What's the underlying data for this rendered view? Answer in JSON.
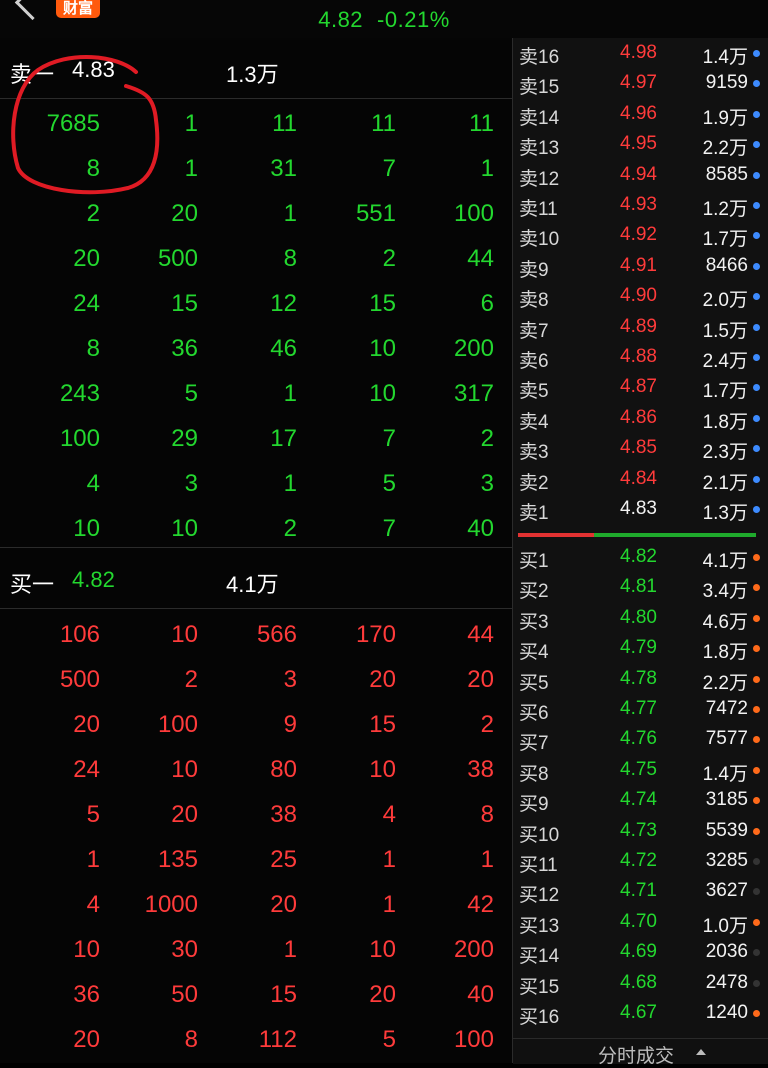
{
  "header": {
    "brand": "财富",
    "price": "4.82",
    "change": "-0.21%"
  },
  "colors": {
    "up": "#ff3b3b",
    "down": "#23d82f",
    "neutral": "#f2f2f2",
    "bar_red": "#e23232",
    "bar_green": "#1faa2c"
  },
  "sell_one": {
    "label": "卖一",
    "price": "4.83",
    "volume": "1.3万"
  },
  "sell_queue": [
    [
      "7685",
      "1",
      "11",
      "11",
      "11"
    ],
    [
      "8",
      "1",
      "31",
      "7",
      "1"
    ],
    [
      "2",
      "20",
      "1",
      "551",
      "100"
    ],
    [
      "20",
      "500",
      "8",
      "2",
      "44"
    ],
    [
      "24",
      "15",
      "12",
      "15",
      "6"
    ],
    [
      "8",
      "36",
      "46",
      "10",
      "200"
    ],
    [
      "243",
      "5",
      "1",
      "10",
      "317"
    ],
    [
      "100",
      "29",
      "17",
      "7",
      "2"
    ],
    [
      "4",
      "3",
      "1",
      "5",
      "3"
    ],
    [
      "10",
      "10",
      "2",
      "7",
      "40"
    ]
  ],
  "buy_one": {
    "label": "买一",
    "price": "4.82",
    "volume": "4.1万"
  },
  "buy_queue": [
    [
      "106",
      "10",
      "566",
      "170",
      "44"
    ],
    [
      "500",
      "2",
      "3",
      "20",
      "20"
    ],
    [
      "20",
      "100",
      "9",
      "15",
      "2"
    ],
    [
      "24",
      "10",
      "80",
      "10",
      "38"
    ],
    [
      "5",
      "20",
      "38",
      "4",
      "8"
    ],
    [
      "1",
      "135",
      "25",
      "1",
      "1"
    ],
    [
      "4",
      "1000",
      "20",
      "1",
      "42"
    ],
    [
      "10",
      "30",
      "1",
      "10",
      "200"
    ],
    [
      "36",
      "50",
      "15",
      "20",
      "40"
    ],
    [
      "20",
      "8",
      "112",
      "5",
      "100"
    ]
  ],
  "asks": [
    {
      "label": "卖16",
      "price": "4.98",
      "volume": "1.4万",
      "dot": "blue"
    },
    {
      "label": "卖15",
      "price": "4.97",
      "volume": "9159",
      "dot": "blue"
    },
    {
      "label": "卖14",
      "price": "4.96",
      "volume": "1.9万",
      "dot": "blue"
    },
    {
      "label": "卖13",
      "price": "4.95",
      "volume": "2.2万",
      "dot": "blue"
    },
    {
      "label": "卖12",
      "price": "4.94",
      "volume": "8585",
      "dot": "blue"
    },
    {
      "label": "卖11",
      "price": "4.93",
      "volume": "1.2万",
      "dot": "blue"
    },
    {
      "label": "卖10",
      "price": "4.92",
      "volume": "1.7万",
      "dot": "blue"
    },
    {
      "label": "卖9",
      "price": "4.91",
      "volume": "8466",
      "dot": "blue"
    },
    {
      "label": "卖8",
      "price": "4.90",
      "volume": "2.0万",
      "dot": "blue"
    },
    {
      "label": "卖7",
      "price": "4.89",
      "volume": "1.5万",
      "dot": "blue"
    },
    {
      "label": "卖6",
      "price": "4.88",
      "volume": "2.4万",
      "dot": "blue"
    },
    {
      "label": "卖5",
      "price": "4.87",
      "volume": "1.7万",
      "dot": "blue"
    },
    {
      "label": "卖4",
      "price": "4.86",
      "volume": "1.8万",
      "dot": "blue"
    },
    {
      "label": "卖3",
      "price": "4.85",
      "volume": "2.3万",
      "dot": "blue"
    },
    {
      "label": "卖2",
      "price": "4.84",
      "volume": "2.1万",
      "dot": "blue"
    },
    {
      "label": "卖1",
      "price": "4.83",
      "volume": "1.3万",
      "dot": "blue"
    }
  ],
  "bids": [
    {
      "label": "买1",
      "price": "4.82",
      "volume": "4.1万",
      "dot": "orange"
    },
    {
      "label": "买2",
      "price": "4.81",
      "volume": "3.4万",
      "dot": "orange"
    },
    {
      "label": "买3",
      "price": "4.80",
      "volume": "4.6万",
      "dot": "orange"
    },
    {
      "label": "买4",
      "price": "4.79",
      "volume": "1.8万",
      "dot": "orange"
    },
    {
      "label": "买5",
      "price": "4.78",
      "volume": "2.2万",
      "dot": "orange"
    },
    {
      "label": "买6",
      "price": "4.77",
      "volume": "7472",
      "dot": "orange"
    },
    {
      "label": "买7",
      "price": "4.76",
      "volume": "7577",
      "dot": "orange"
    },
    {
      "label": "买8",
      "price": "4.75",
      "volume": "1.4万",
      "dot": "orange"
    },
    {
      "label": "买9",
      "price": "4.74",
      "volume": "3185",
      "dot": "orange"
    },
    {
      "label": "买10",
      "price": "4.73",
      "volume": "5539",
      "dot": "orange"
    },
    {
      "label": "买11",
      "price": "4.72",
      "volume": "3285",
      "dot": "dark"
    },
    {
      "label": "买12",
      "price": "4.71",
      "volume": "3627",
      "dot": "dark"
    },
    {
      "label": "买13",
      "price": "4.70",
      "volume": "1.0万",
      "dot": "orange"
    },
    {
      "label": "买14",
      "price": "4.69",
      "volume": "2036",
      "dot": "dark"
    },
    {
      "label": "买15",
      "price": "4.68",
      "volume": "2478",
      "dot": "dark"
    },
    {
      "label": "买16",
      "price": "4.67",
      "volume": "1240",
      "dot": "orange"
    }
  ],
  "footer": {
    "label": "分时成交"
  }
}
